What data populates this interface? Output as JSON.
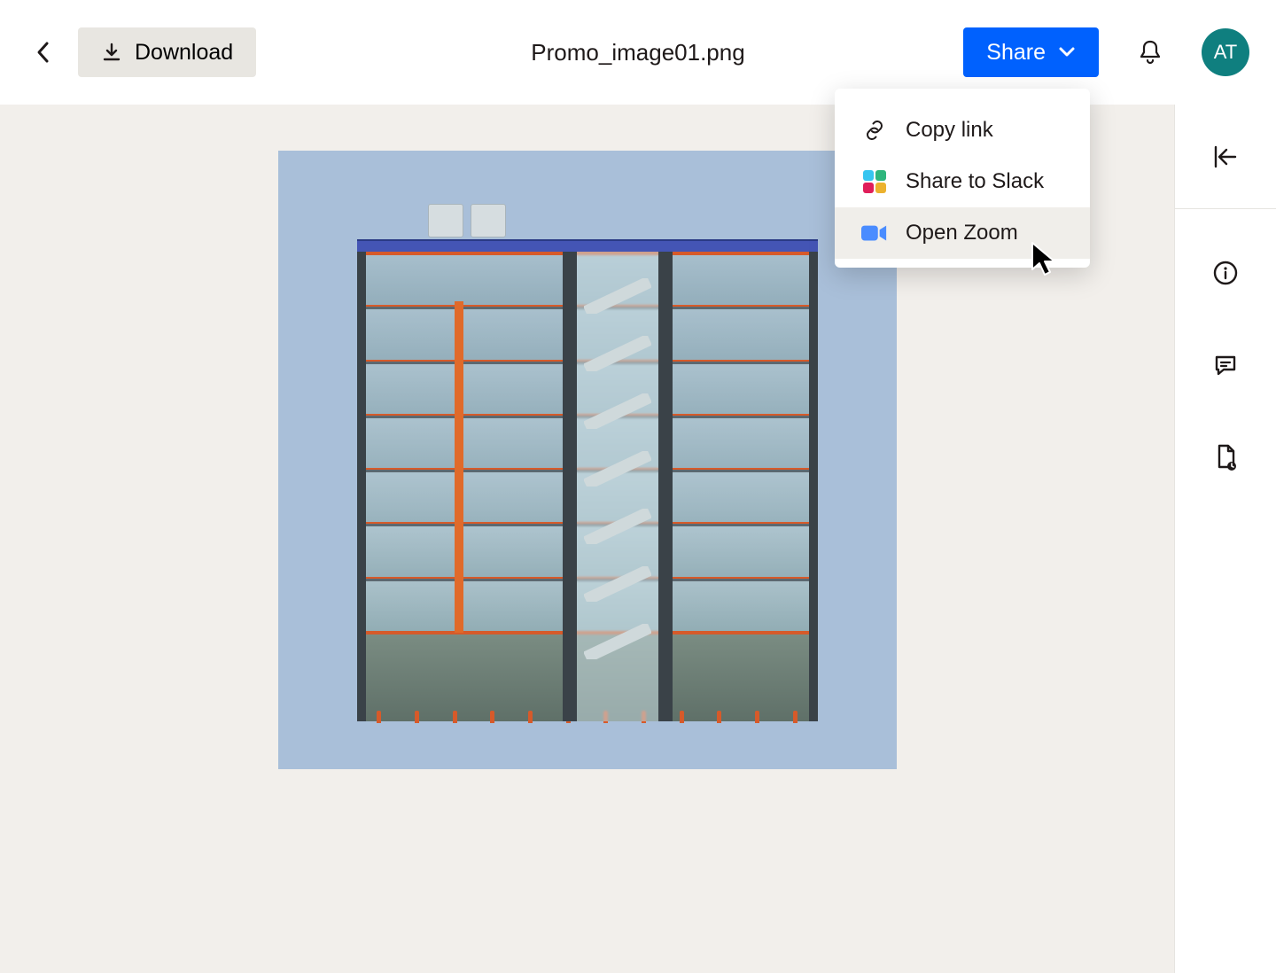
{
  "header": {
    "download_label": "Download",
    "file_title": "Promo_image01.png",
    "share_label": "Share",
    "avatar_initials": "AT"
  },
  "share_menu": {
    "items": [
      {
        "icon": "link-icon",
        "label": "Copy link",
        "hovered": false
      },
      {
        "icon": "slack-icon",
        "label": "Share to Slack",
        "hovered": false
      },
      {
        "icon": "zoom-icon",
        "label": "Open Zoom",
        "hovered": true
      }
    ]
  },
  "right_rail": {
    "icons": [
      "collapse-panel-icon",
      "info-icon",
      "comment-icon",
      "file-activity-icon"
    ]
  },
  "colors": {
    "accent": "#0061fe",
    "avatar_bg": "#0f7f7f",
    "viewer_bg": "#f2efeb",
    "image_bg": "#a9bfd9",
    "building_orange": "#d65a2a"
  }
}
